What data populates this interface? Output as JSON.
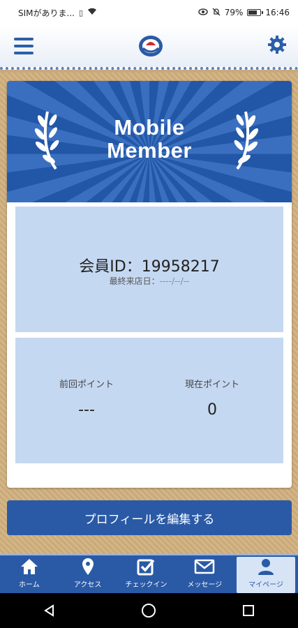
{
  "status_bar": {
    "carrier": "SIMがありま...",
    "battery_percent": "79%",
    "battery_level": 0.79,
    "time": "16:46"
  },
  "header": {
    "menu_icon": "hamburger-menu-icon",
    "logo_icon": "brand-logo-icon",
    "settings_icon": "gear-icon"
  },
  "banner": {
    "title_line1": "Mobile",
    "title_line2": "Member"
  },
  "member": {
    "id_label": "会員ID：",
    "id_value": "19958217",
    "last_visit_label": "最終来店日：",
    "last_visit_value": "----/--/--"
  },
  "points": {
    "previous_label": "前回ポイント",
    "previous_value": "---",
    "current_label": "現在ポイント",
    "current_value": "0"
  },
  "edit_button": "プロフィールを編集する",
  "tabs": [
    {
      "label": "ホーム",
      "icon": "home-icon"
    },
    {
      "label": "アクセス",
      "icon": "map-pin-icon"
    },
    {
      "label": "チェックイン",
      "icon": "checkin-icon"
    },
    {
      "label": "メッセージ",
      "icon": "envelope-icon"
    },
    {
      "label": "マイページ",
      "icon": "person-icon",
      "active": true
    }
  ],
  "colors": {
    "primary": "#2a5aa6",
    "panel": "#c5d8f1",
    "background": "#c9a97a"
  }
}
